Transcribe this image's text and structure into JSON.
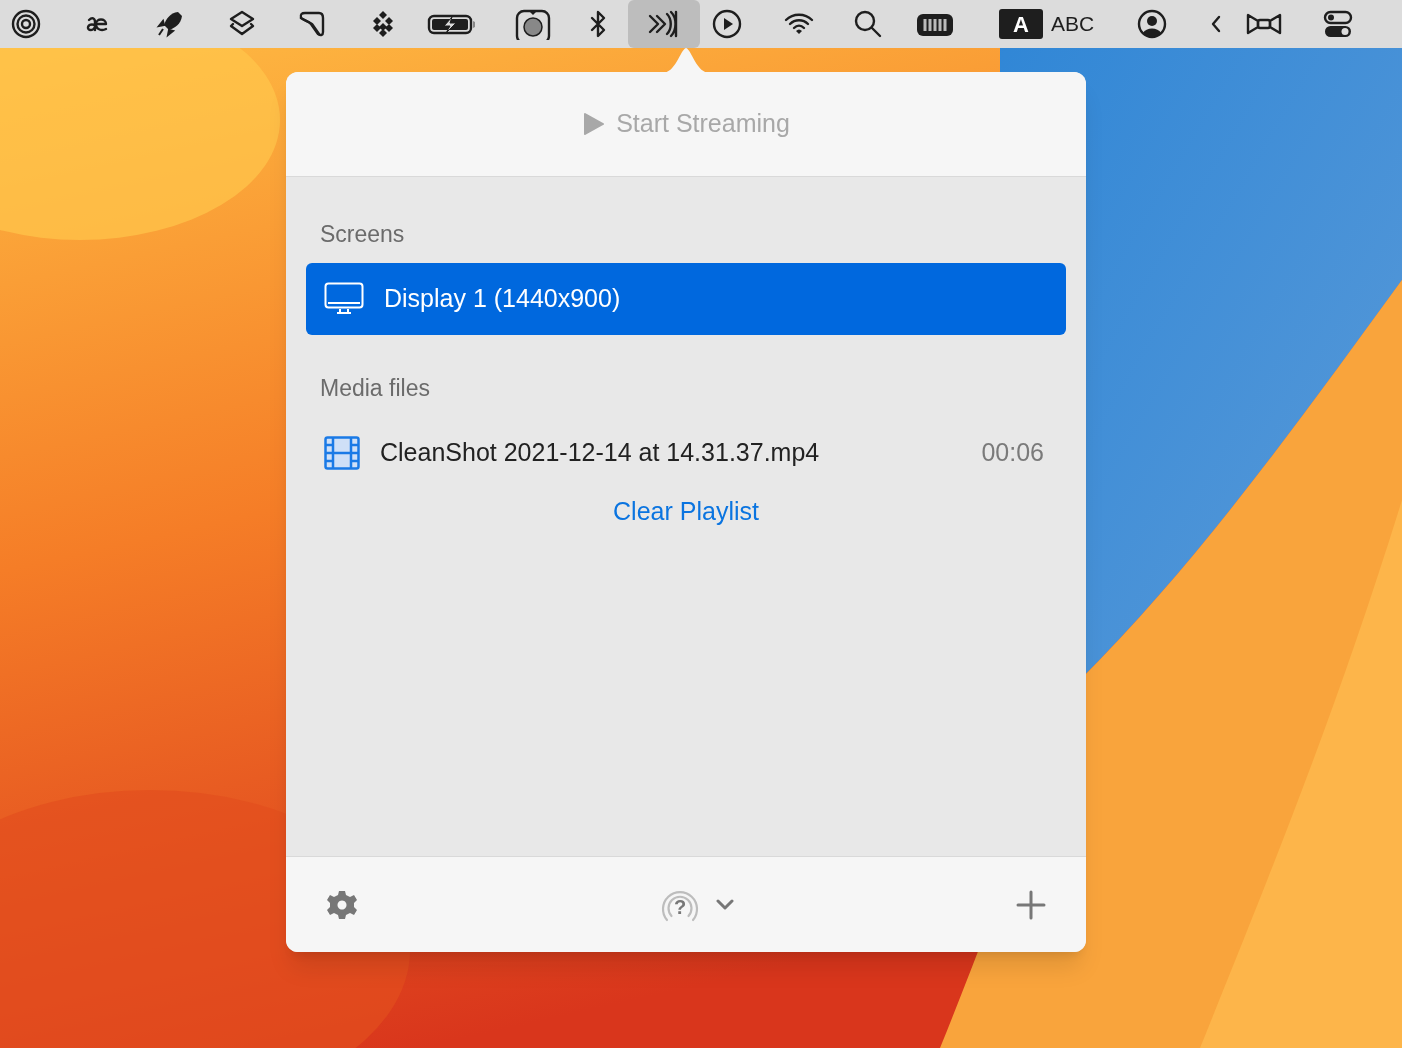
{
  "menu_bar": {
    "items": [
      {
        "kind": "icon",
        "selected": false
      },
      {
        "kind": "icon",
        "selected": false
      },
      {
        "kind": "icon",
        "selected": false
      },
      {
        "kind": "icon",
        "selected": false
      },
      {
        "kind": "icon",
        "selected": false
      },
      {
        "kind": "icon",
        "selected": false
      },
      {
        "kind": "icon",
        "selected": false
      },
      {
        "kind": "icon",
        "selected": false
      },
      {
        "kind": "icon",
        "selected": false
      },
      {
        "kind": "icon",
        "selected": true
      },
      {
        "kind": "icon",
        "selected": false
      },
      {
        "kind": "icon",
        "selected": false
      },
      {
        "kind": "icon",
        "selected": false
      },
      {
        "kind": "icon",
        "selected": false
      },
      {
        "kind": "input-source",
        "badge": "A",
        "label": "ABC",
        "selected": false
      },
      {
        "kind": "icon",
        "selected": false
      },
      {
        "kind": "icon",
        "selected": false
      },
      {
        "kind": "icon",
        "selected": false
      },
      {
        "kind": "icon",
        "selected": false
      }
    ]
  },
  "popover": {
    "start_button": {
      "label": "Start Streaming",
      "disabled": true
    },
    "sections": [
      {
        "title": "Screens",
        "items": [
          {
            "kind": "screen",
            "name": "Display 1 (1440x900)",
            "selected": true
          }
        ]
      },
      {
        "title": "Media files",
        "items": [
          {
            "kind": "media",
            "name": "CleanShot 2021-12-14 at 14.31.37.mp4",
            "duration": "00:06",
            "selected": false
          }
        ]
      }
    ],
    "clear_link": "Clear Playlist",
    "footer": {
      "device_glyph": "?"
    }
  }
}
